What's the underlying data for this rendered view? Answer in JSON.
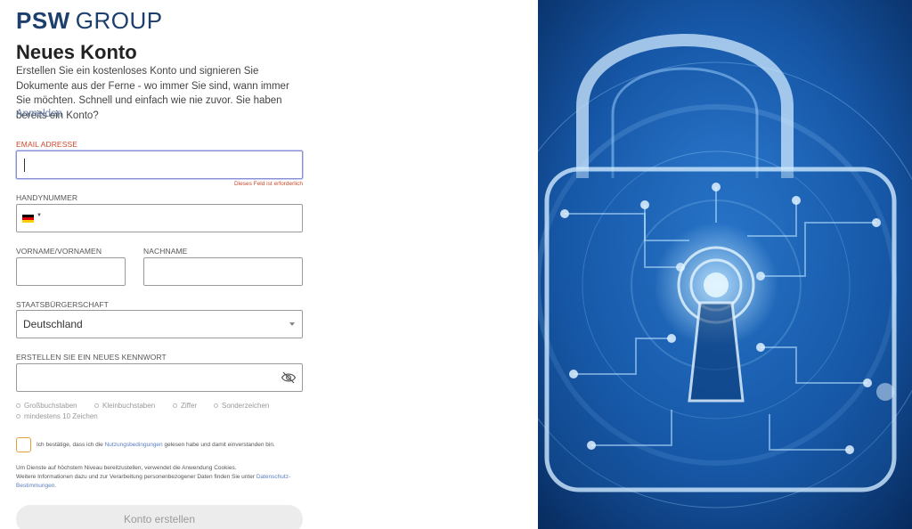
{
  "brand": {
    "bold": "PSW",
    "normal": "GROUP"
  },
  "heading": "Neues Konto",
  "intro": "Erstellen Sie ein kostenloses Konto und signieren Sie Dokumente aus der Ferne - wo immer Sie sind, wann immer Sie möchten. Schnell und einfach wie nie zuvor. Sie haben bereits ein Konto?",
  "signin_link": "Anmelden",
  "form": {
    "email": {
      "label": "EMAIL ADRESSE",
      "value": "",
      "error": "Dieses Feld ist erforderlich"
    },
    "phone": {
      "label": "HANDYNUMMER",
      "country": "DE",
      "value": ""
    },
    "firstname": {
      "label": "VORNAME/VORNAMEN",
      "value": ""
    },
    "lastname": {
      "label": "NACHNAME",
      "value": ""
    },
    "citizenship": {
      "label": "STAATSBÜRGERSCHAFT",
      "value": "Deutschland"
    },
    "password": {
      "label": "ERSTELLEN SIE EIN NEUES KENNWORT",
      "value": ""
    },
    "requirements": [
      "Großbuchstaben",
      "Kleinbuchstaben",
      "Ziffer",
      "Sonderzeichen",
      "mindestens 10 Zeichen"
    ],
    "terms": {
      "before": "Ich bestätige, dass ich die ",
      "link": "Nutzungsbedingungen",
      "after": " gelesen habe und damit einverstanden bin."
    },
    "cookie": {
      "line1": "Um Dienste auf höchstem Niveau bereitzustellen, verwendet die Anwendung Cookies.",
      "line2": "Weitere Informationen dazu und zur Verarbeitung personenbezogener Daten finden Sie unter ",
      "link": "Datenschutz-Bestimmungen",
      "end": "."
    },
    "submit": "Konto erstellen"
  },
  "colors": {
    "brand": "#1d3f6e",
    "error": "#c9482a",
    "link": "#5a7ec0",
    "checkbox_border": "#e2a13a",
    "hero_bg": "#0b3a78"
  },
  "icons": {
    "flag": "germany-flag-icon",
    "eye": "eye-slash-icon",
    "dropdown": "chevron-down-icon",
    "hero": "padlock-circuit-image"
  }
}
